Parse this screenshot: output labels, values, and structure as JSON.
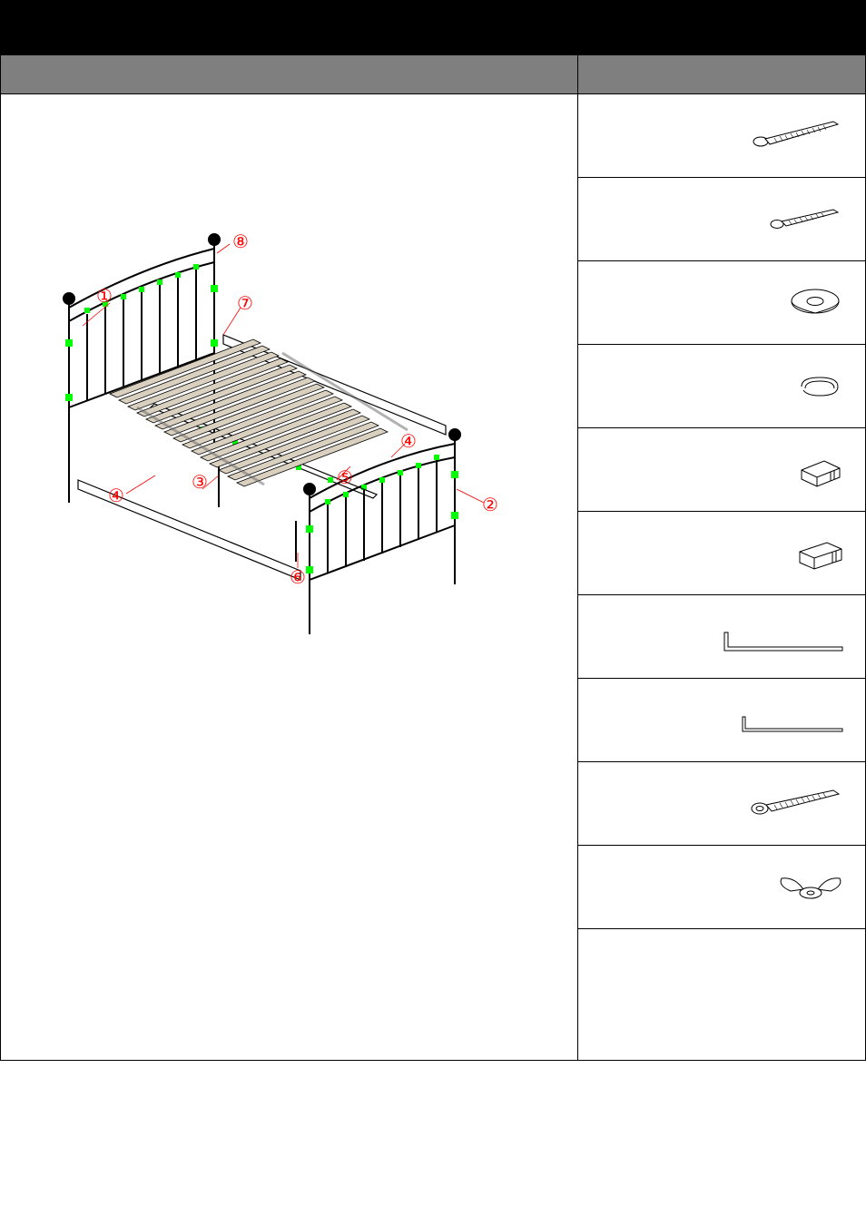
{
  "callouts": {
    "c1": "①",
    "c2": "②",
    "c3": "③",
    "c4a": "④",
    "c4b": "④",
    "c5": "⑤",
    "c6": "⑥",
    "c7": "⑦",
    "c8": "⑧"
  }
}
